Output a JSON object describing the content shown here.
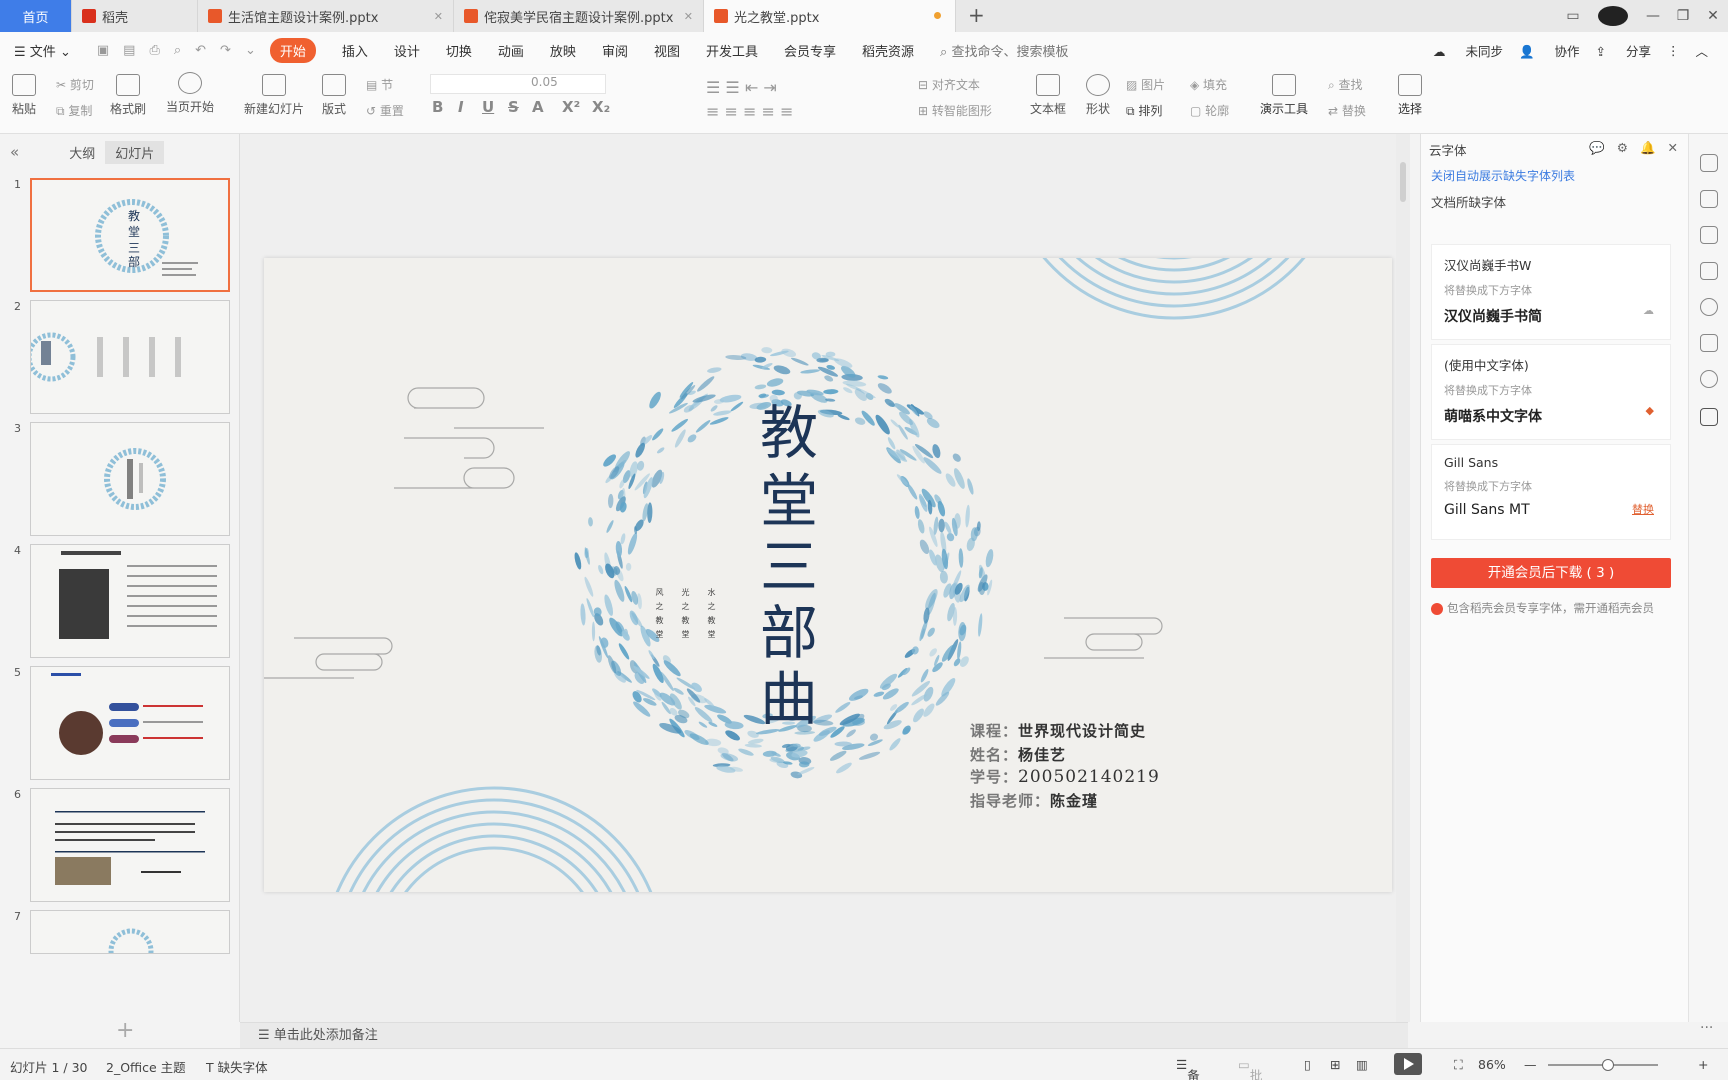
{
  "tabs": [
    {
      "label": "首页",
      "kind": "home"
    },
    {
      "label": "稻壳",
      "kind": "wps"
    },
    {
      "label": "生活馆主题设计案例.pptx",
      "kind": "ppt"
    },
    {
      "label": "侘寂美学民宿主题设计案例.pptx",
      "kind": "ppt"
    },
    {
      "label": "光之教堂.pptx",
      "kind": "ppt",
      "active": true
    }
  ],
  "menu": {
    "file": "文件",
    "items": [
      "开始",
      "插入",
      "设计",
      "切换",
      "动画",
      "放映",
      "审阅",
      "视图",
      "开发工具",
      "会员专享",
      "稻壳资源"
    ],
    "search_placeholder": "查找命令、搜索模板",
    "sync": "未同步",
    "collab": "协作",
    "share": "分享"
  },
  "ribbon": {
    "paste": "粘贴",
    "cut": "剪切",
    "copy": "复制",
    "format_painter": "格式刷",
    "start_from_current": "当页开始",
    "new_slide": "新建幻灯片",
    "layout": "版式",
    "section": "节",
    "reset": "重置",
    "font_size": "0.05",
    "align_text": "对齐文本",
    "smart_shape": "转智能图形",
    "textbox": "文本框",
    "shape": "形状",
    "arrange": "排列",
    "picture": "图片",
    "fill": "填充",
    "outline": "轮廓",
    "present_tools": "演示工具",
    "find": "查找",
    "replace": "替换",
    "select": "选择"
  },
  "left_panel": {
    "tab_outline": "大纲",
    "tab_slides": "幻灯片",
    "thumbnails": [
      "1",
      "2",
      "3",
      "4",
      "5",
      "6",
      "7"
    ]
  },
  "slide": {
    "title_chars": [
      "教",
      "堂",
      "三",
      "部",
      "曲"
    ],
    "vertical_columns": [
      "风之教堂",
      "光之教堂",
      "水之教堂"
    ],
    "course_label": "课程：",
    "course_value": "世界现代设计简史",
    "name_label": "姓名：",
    "name_value": "杨佳艺",
    "id_label": "学号：",
    "id_value": "200502140219",
    "teacher_label": "指导老师：",
    "teacher_value": "陈金瑾",
    "colors": {
      "title": "#1d3557",
      "fish": "#5fa4c8",
      "accent": "#9cc6dc"
    }
  },
  "notes_placeholder": "单击此处添加备注",
  "right_panel": {
    "header": "云字体",
    "close_link": "关闭自动展示缺失字体列表",
    "section_title": "文档所缺字体",
    "fonts": [
      {
        "name": "汉仪尚巍手书W",
        "hint": "将替换成下方字体",
        "replacement": "汉仪尚巍手书简",
        "action": ""
      },
      {
        "name": "(使用中文字体)",
        "hint": "将替换成下方字体",
        "replacement": "萌喵系中文字体",
        "action": ""
      },
      {
        "name": "Gill Sans",
        "hint": "将替换成下方字体",
        "replacement": "Gill Sans MT",
        "action": "替换"
      }
    ],
    "download_button": "开通会员后下载 ( 3 )",
    "note": "包含稻壳会员专享字体，需开通稻壳会员"
  },
  "status": {
    "slide_counter": "幻灯片 1 / 30",
    "theme": "2_Office 主题",
    "missing_fonts": "缺失字体",
    "notes": "备注",
    "comments": "批注",
    "zoom": "86%"
  }
}
